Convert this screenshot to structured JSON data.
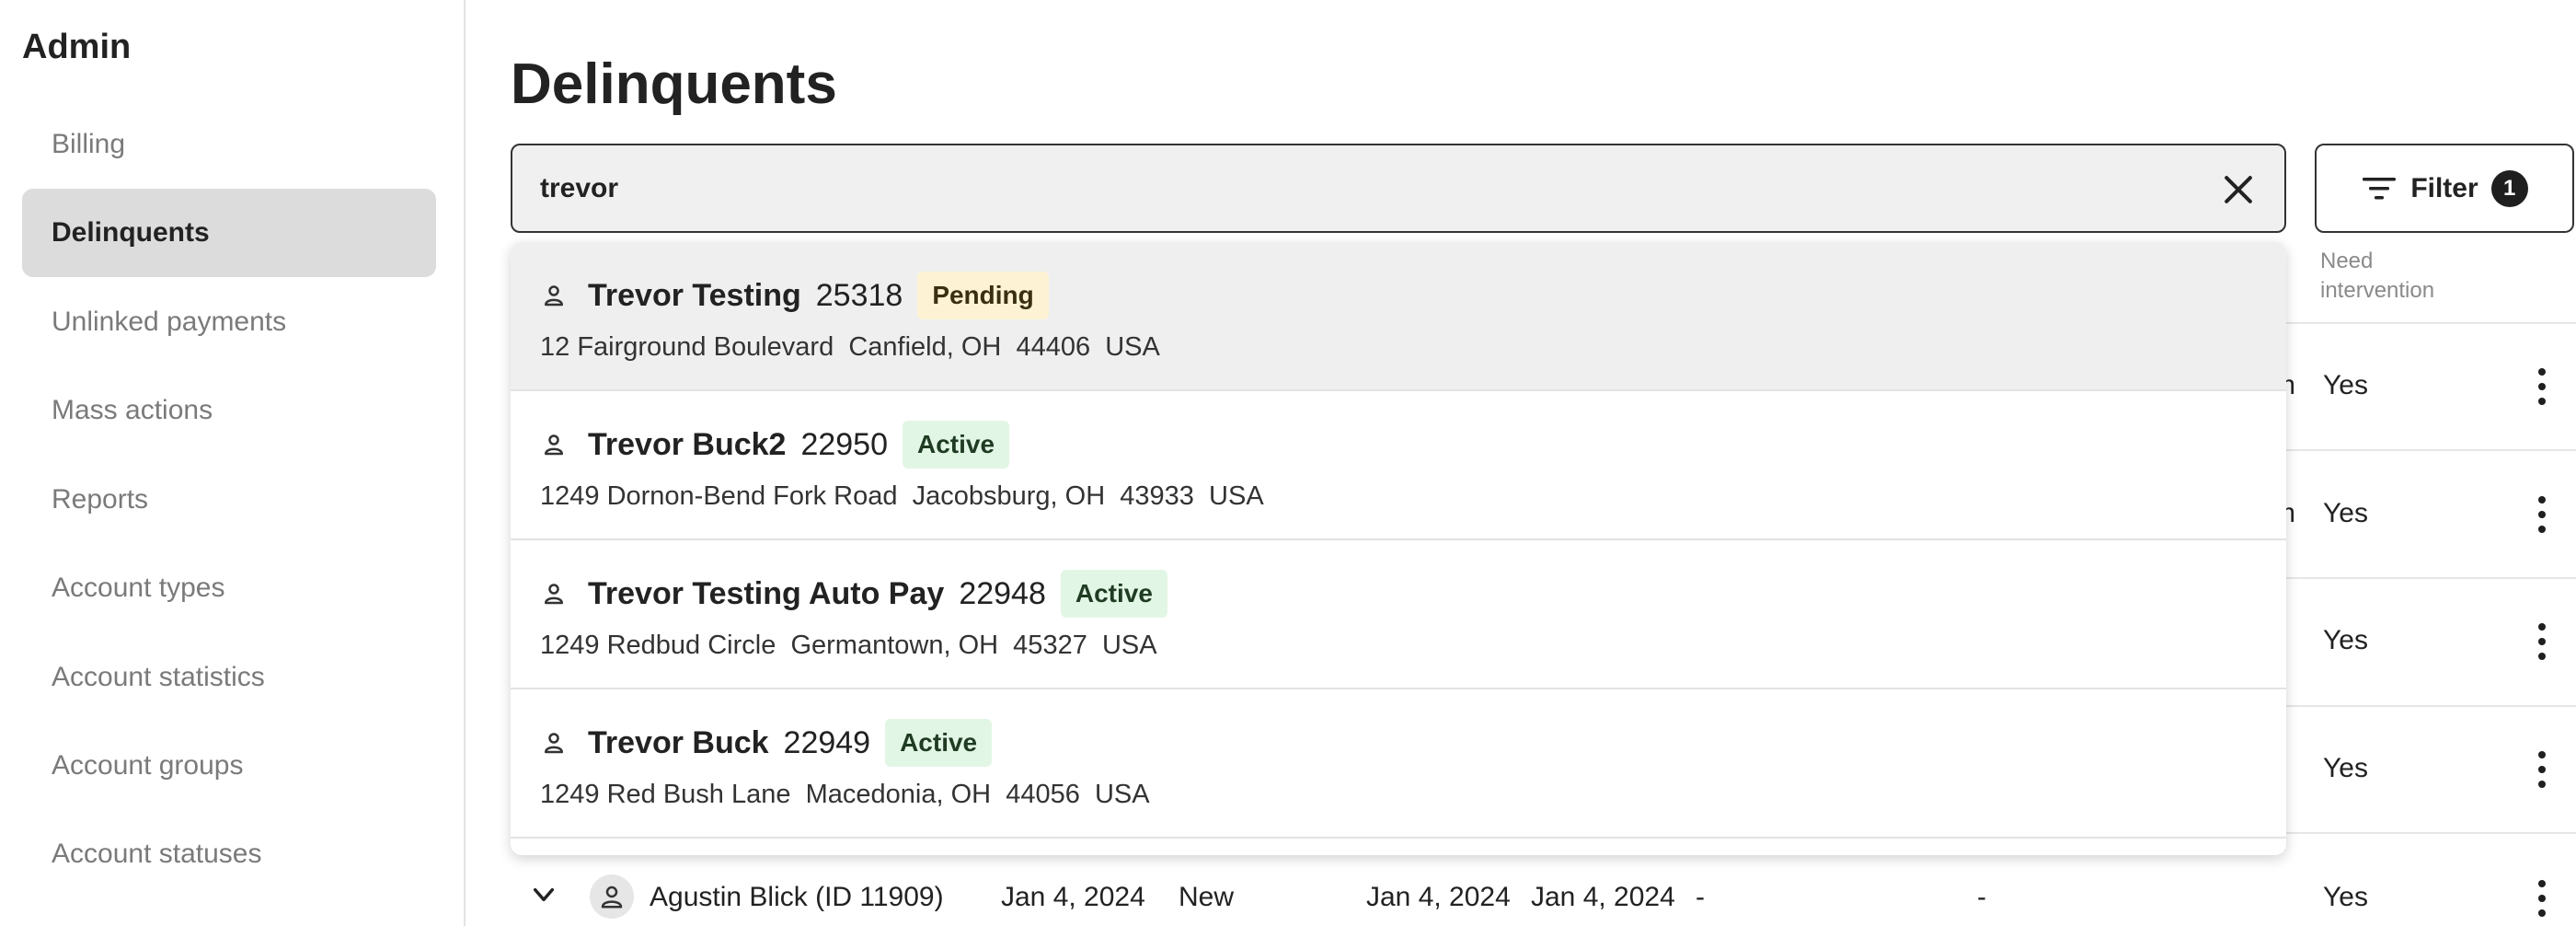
{
  "sidebar": {
    "title": "Admin",
    "items": [
      {
        "label": "Billing",
        "active": false
      },
      {
        "label": "Delinquents",
        "active": true
      },
      {
        "label": "Unlinked payments",
        "active": false
      },
      {
        "label": "Mass actions",
        "active": false
      },
      {
        "label": "Reports",
        "active": false
      },
      {
        "label": "Account types",
        "active": false
      },
      {
        "label": "Account statistics",
        "active": false
      },
      {
        "label": "Account groups",
        "active": false
      },
      {
        "label": "Account statuses",
        "active": false
      }
    ]
  },
  "main": {
    "title": "Delinquents",
    "search": {
      "value": "trevor"
    },
    "filter": {
      "label": "Filter",
      "count": "1"
    },
    "table": {
      "header_need_intervention": "Need\nintervention",
      "rows": [
        {
          "partial": "m",
          "need_intervention": "Yes"
        },
        {
          "partial": "m",
          "need_intervention": "Yes"
        },
        {
          "partial": "",
          "need_intervention": "Yes"
        },
        {
          "partial": "",
          "need_intervention": "Yes"
        }
      ],
      "last_row": {
        "name": "Agustin Blick (ID 11909)",
        "date1": "Jan 4, 2024",
        "status": "New",
        "date2": "Jan 4, 2024",
        "date3": "Jan 4, 2024",
        "dash1": "-",
        "dash2": "-",
        "need_intervention": "Yes"
      }
    },
    "results": [
      {
        "name": "Trevor Testing",
        "id": "25318",
        "status": "Pending",
        "status_type": "pending",
        "address": "12 Fairground Boulevard  Canfield, OH  44406  USA"
      },
      {
        "name": "Trevor Buck2",
        "id": "22950",
        "status": "Active",
        "status_type": "active",
        "address": "1249 Dornon-Bend Fork Road  Jacobsburg, OH  43933  USA"
      },
      {
        "name": "Trevor Testing Auto Pay",
        "id": "22948",
        "status": "Active",
        "status_type": "active",
        "address": "1249 Redbud Circle  Germantown, OH  45327  USA"
      },
      {
        "name": "Trevor Buck",
        "id": "22949",
        "status": "Active",
        "status_type": "active",
        "address": "1249 Red Bush Lane  Macedonia, OH  44056  USA"
      }
    ]
  },
  "colors": {
    "active_nav_bg": "#dcdcdc",
    "pending_badge_bg": "#fdf3d4",
    "active_badge_bg": "#e2f6e5",
    "hover_row_bg": "#efefef"
  }
}
